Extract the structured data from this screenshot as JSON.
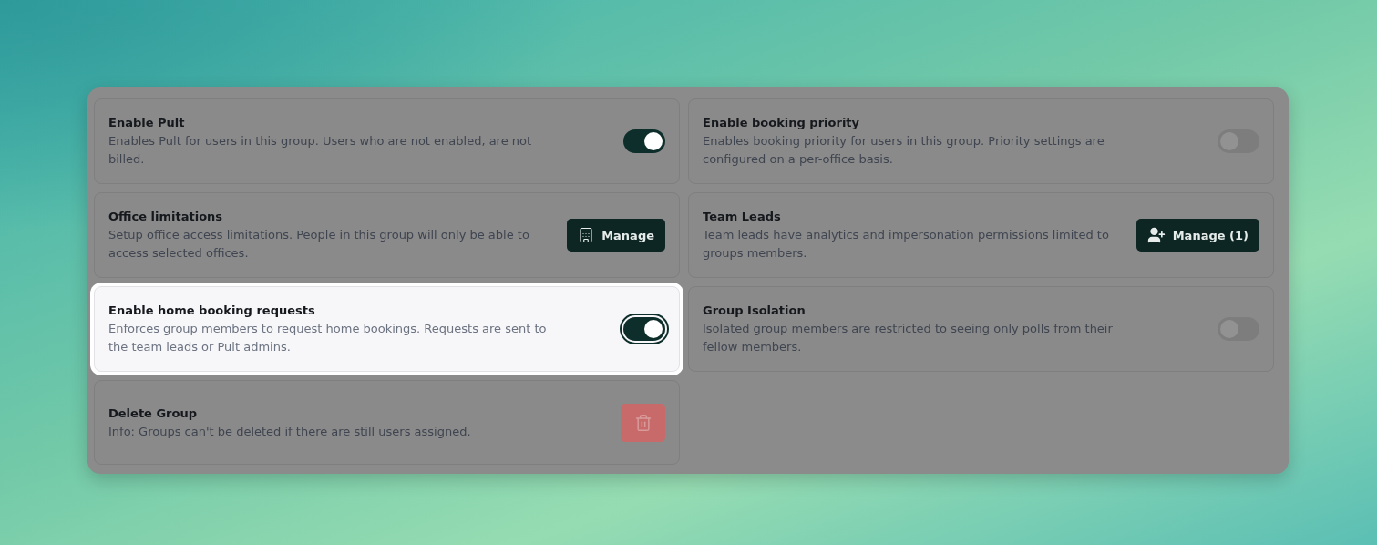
{
  "settings": [
    {
      "kind": "toggle",
      "title": "Enable Pult",
      "description": "Enables Pult for users in this group. Users who are not enabled, are not billed.",
      "on": true,
      "highlighted": false
    },
    {
      "kind": "toggle",
      "title": "Enable booking priority",
      "description": "Enables booking priority for users in this group. Priority settings are configured on a per-office basis.",
      "on": false,
      "highlighted": false
    },
    {
      "kind": "offices",
      "title": "Office limitations",
      "description": "Setup office access limitations. People in this group will only be able to access selected offices.",
      "button": "Manage",
      "highlighted": false
    },
    {
      "kind": "team",
      "title": "Team Leads",
      "description": "Team leads have analytics and impersonation permissions limited to groups members.",
      "button": "Manage (1)",
      "highlighted": false
    },
    {
      "kind": "toggle",
      "title": "Enable home booking requests",
      "description": "Enforces group members to request home bookings. Requests are sent to the team leads or Pult admins.",
      "on": true,
      "highlighted": true
    },
    {
      "kind": "toggle",
      "title": "Group Isolation",
      "description": "Isolated group members are restricted to seeing only polls from their fellow members.",
      "on": false,
      "highlighted": false
    },
    {
      "kind": "delete",
      "title": "Delete Group",
      "description": "Info: Groups can't be deleted if there are still users assigned.",
      "highlighted": false
    }
  ]
}
